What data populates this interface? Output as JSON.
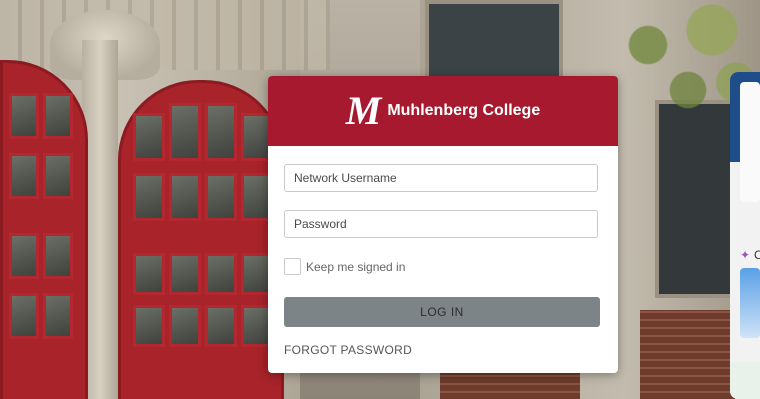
{
  "header": {
    "logo_mark": "M",
    "brand": "Muhlenberg College"
  },
  "form": {
    "username_placeholder": "Network Username",
    "username_value": "",
    "password_placeholder": "Password",
    "password_value": "",
    "keep_signed_in_label": "Keep me signed in",
    "keep_signed_in_checked": false,
    "login_label": "LOG IN",
    "forgot_label": "FORGOT PASSWORD"
  },
  "colors": {
    "brand_red": "#a6192e",
    "button_gray": "#7c8487"
  },
  "side_panel": {
    "star_icon": "sparkle-icon",
    "partial_text": "C"
  }
}
